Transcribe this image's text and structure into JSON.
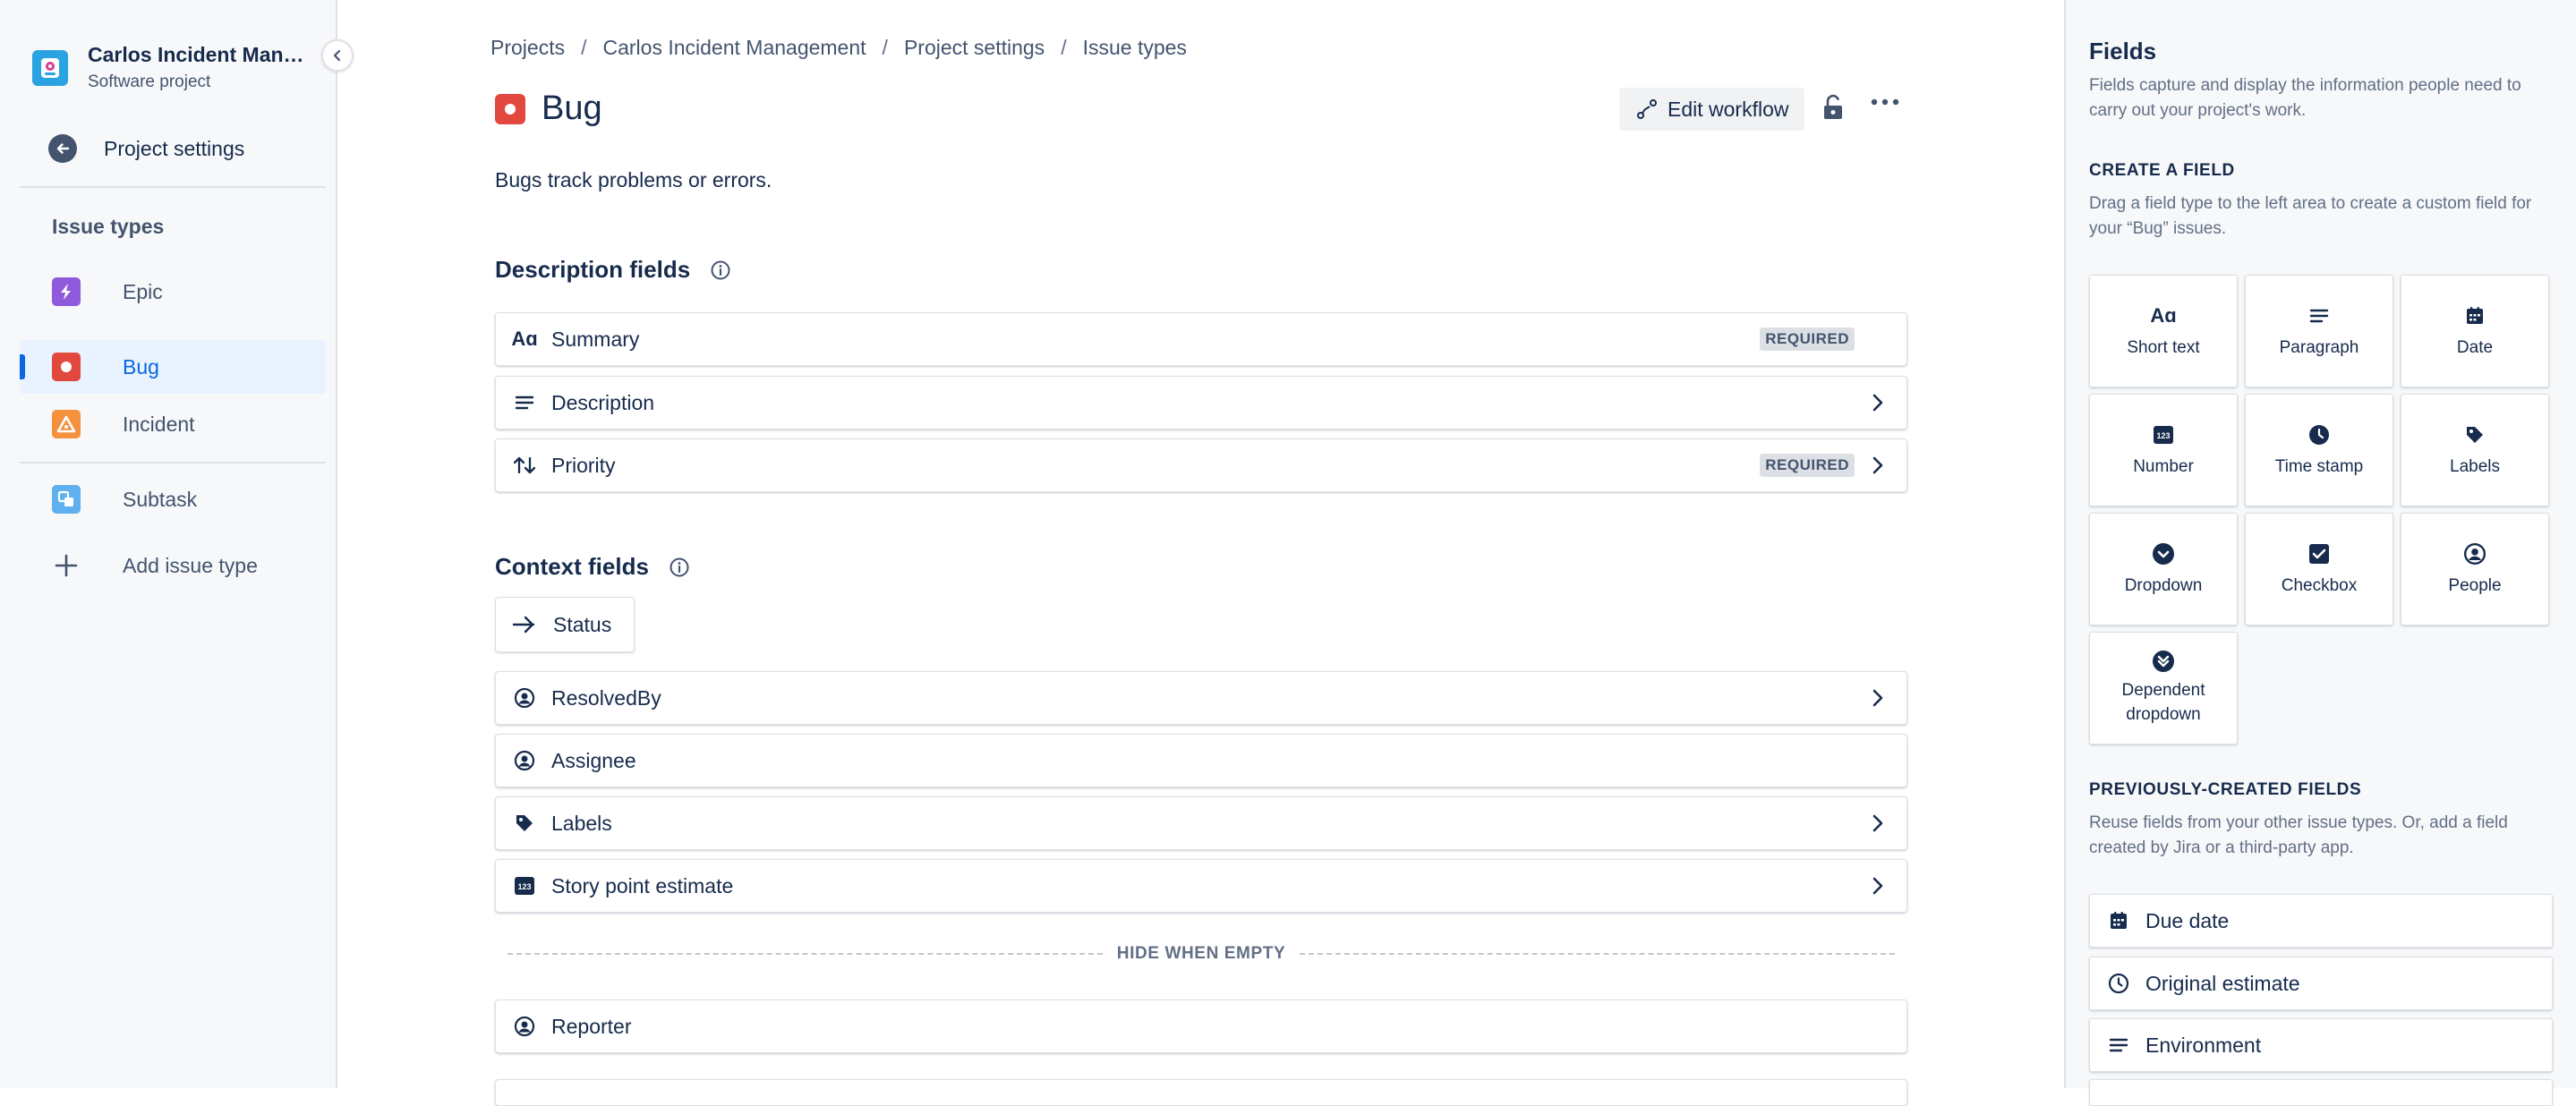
{
  "sidebar": {
    "project_name": "Carlos Incident Management",
    "project_type": "Software project",
    "back_label": "Project settings",
    "section_label": "Issue types",
    "items": [
      {
        "label": "Epic",
        "icon": "epic-icon",
        "color": "#8f5bdc"
      },
      {
        "label": "Bug",
        "icon": "bug-icon",
        "color": "#e2483d",
        "active": true
      },
      {
        "label": "Incident",
        "icon": "incident-icon",
        "color": "#f5903d"
      },
      {
        "label": "Subtask",
        "icon": "subtask-icon",
        "color": "#5eb0ef"
      }
    ],
    "add_label": "Add issue type"
  },
  "breadcrumb": [
    "Projects",
    "Carlos Incident Management",
    "Project settings",
    "Issue types"
  ],
  "header": {
    "title": "Bug",
    "edit_workflow_label": "Edit workflow",
    "description": "Bugs track problems or errors."
  },
  "description_fields": {
    "title": "Description fields",
    "rows": [
      {
        "label": "Summary",
        "icon": "text-icon",
        "required": "REQUIRED",
        "chevron": false
      },
      {
        "label": "Description",
        "icon": "paragraph-icon",
        "required": "",
        "chevron": true
      },
      {
        "label": "Priority",
        "icon": "priority-icon",
        "required": "REQUIRED",
        "chevron": true
      }
    ]
  },
  "context_fields": {
    "title": "Context fields",
    "status_label": "Status",
    "rows": [
      {
        "label": "ResolvedBy",
        "icon": "person-icon",
        "chevron": true
      },
      {
        "label": "Assignee",
        "icon": "person-icon",
        "chevron": false
      },
      {
        "label": "Labels",
        "icon": "tag-icon",
        "chevron": true
      },
      {
        "label": "Story point estimate",
        "icon": "number-icon",
        "chevron": true
      }
    ],
    "hide_when_empty_label": "HIDE WHEN EMPTY",
    "hidden_rows": [
      {
        "label": "Reporter",
        "icon": "person-icon"
      }
    ]
  },
  "fields_panel": {
    "title": "Fields",
    "description": "Fields capture and display the information people need to carry out your project's work.",
    "create_heading": "CREATE A FIELD",
    "create_description": "Drag a field type to the left area to create a custom field for your “Bug” issues.",
    "field_types": [
      {
        "label": "Short text",
        "icon": "short-text-icon"
      },
      {
        "label": "Paragraph",
        "icon": "paragraph-icon"
      },
      {
        "label": "Date",
        "icon": "calendar-icon"
      },
      {
        "label": "Number",
        "icon": "number-icon"
      },
      {
        "label": "Time stamp",
        "icon": "clock-icon"
      },
      {
        "label": "Labels",
        "icon": "tag-icon"
      },
      {
        "label": "Dropdown",
        "icon": "dropdown-icon"
      },
      {
        "label": "Checkbox",
        "icon": "checkbox-icon"
      },
      {
        "label": "People",
        "icon": "person-icon"
      },
      {
        "label": "Dependent dropdown",
        "icon": "dependent-dropdown-icon"
      }
    ],
    "previous_heading": "PREVIOUSLY-CREATED FIELDS",
    "previous_description": "Reuse fields from your other issue types. Or, add a field created by Jira or a third-party app.",
    "previous_fields": [
      {
        "label": "Due date",
        "icon": "calendar-icon"
      },
      {
        "label": "Original estimate",
        "icon": "clock-outline-icon"
      },
      {
        "label": "Environment",
        "icon": "paragraph-icon"
      }
    ]
  }
}
